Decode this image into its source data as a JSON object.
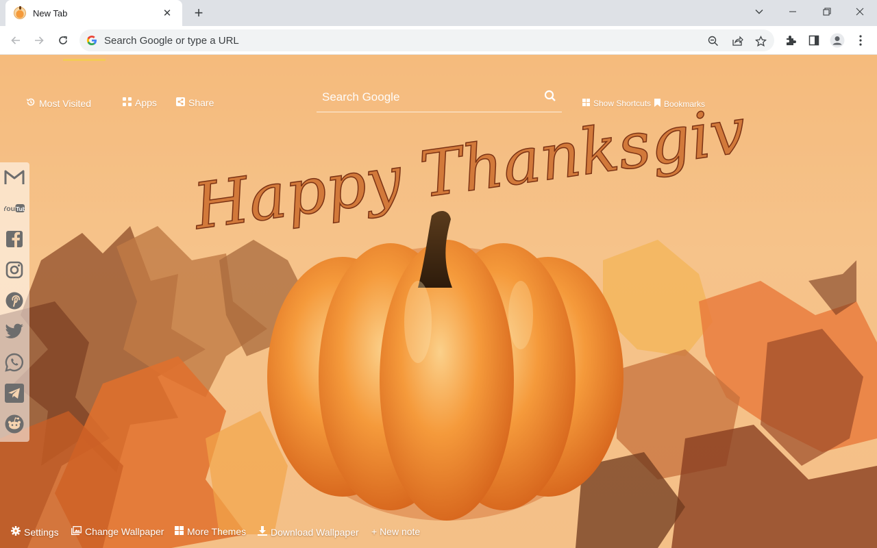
{
  "browser": {
    "tab": {
      "title": "New Tab",
      "close_glyph": "✕"
    },
    "new_tab_glyph": "+",
    "omnibox": {
      "placeholder": "Search Google or type a URL"
    },
    "icons": [
      "back-icon",
      "forward-icon",
      "reload-icon",
      "zoom-icon",
      "share-icon",
      "star-icon",
      "extensions-icon",
      "side-panel-icon",
      "profile-icon",
      "menu-icon"
    ]
  },
  "ntp": {
    "top_left": {
      "most_visited": "Most Visited",
      "apps": "Apps",
      "share": "Share"
    },
    "search": {
      "placeholder": "Search Google"
    },
    "top_right": {
      "show_shortcuts": "Show Shortcuts",
      "bookmarks": "Bookmarks"
    },
    "headline": "Happy Thanksgiving!",
    "sidebar": [
      "gmail-icon",
      "youtube-icon",
      "facebook-icon",
      "instagram-icon",
      "pinterest-icon",
      "twitter-icon",
      "whatsapp-icon",
      "telegram-icon",
      "reddit-icon"
    ],
    "bottom": {
      "settings": "Settings",
      "change_wallpaper": "Change Wallpaper",
      "more_themes": "More Themes",
      "download_wallpaper": "Download Wallpaper",
      "new_note": "+ New note"
    }
  }
}
